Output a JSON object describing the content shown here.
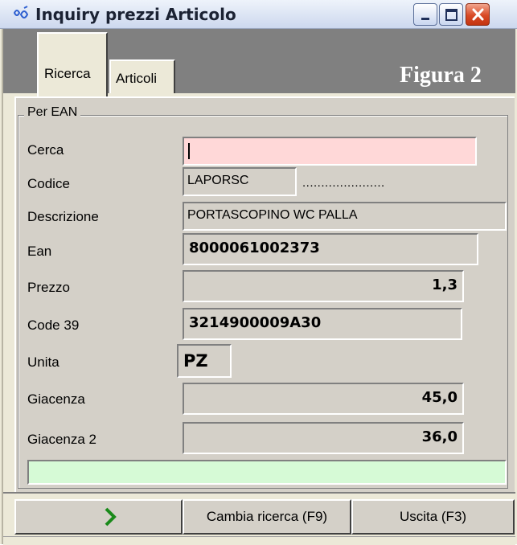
{
  "window": {
    "title": "Inquiry prezzi Articolo",
    "icon": "app-logo-icon",
    "controls": [
      "minimize-icon",
      "maximize-icon",
      "close-icon"
    ]
  },
  "tabs": [
    {
      "label": "Ricerca",
      "active": true
    },
    {
      "label": "Articoli",
      "active": false
    }
  ],
  "figure_label": "Figura 2",
  "group": {
    "title": "Per EAN"
  },
  "fields": {
    "cerca": {
      "label": "Cerca",
      "value": ""
    },
    "codice": {
      "label": "Codice",
      "value": "LAPORSC",
      "extra": "......................"
    },
    "descrizione": {
      "label": "Descrizione",
      "value": "PORTASCOPINO WC PALLA"
    },
    "ean": {
      "label": "Ean",
      "value": "8000061002373"
    },
    "prezzo": {
      "label": "Prezzo",
      "value": "1,3"
    },
    "code39": {
      "label": "Code 39",
      "value": "3214900009A30"
    },
    "unita": {
      "label": "Unita",
      "value": "PZ"
    },
    "giacenza": {
      "label": "Giacenza",
      "value": "45,0"
    },
    "giacenza2": {
      "label": "Giacenza 2",
      "value": "36,0"
    }
  },
  "status_bar": {
    "text": "",
    "color": "#d6fad6"
  },
  "buttons": {
    "next": {
      "icon": "chevron-right-icon",
      "color": "#1a8a1a"
    },
    "cambia": {
      "label": "Cambia ricerca (F9)"
    },
    "uscita": {
      "label": "Uscita (F3)"
    }
  },
  "colors": {
    "search_bg": "#ffd8d8",
    "panel_bg": "#d4d0c8",
    "close_btn": "#d94a26"
  }
}
